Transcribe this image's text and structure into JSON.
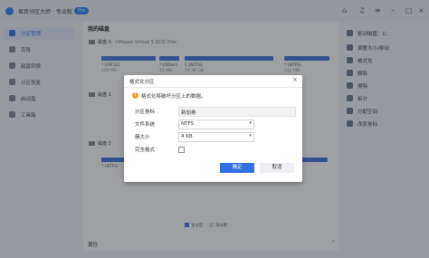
{
  "app": {
    "title": "易我分区大师 · 专业版",
    "badge": "Pro"
  },
  "sidebar": {
    "items": [
      {
        "label": "分区管理",
        "active": true
      },
      {
        "label": "克隆"
      },
      {
        "label": "磁盘转换"
      },
      {
        "label": "分区恢复"
      },
      {
        "label": "启动盘"
      },
      {
        "label": "工具箱"
      }
    ]
  },
  "main": {
    "title": "我的磁盘",
    "disks": [
      {
        "label": "磁盘 0",
        "info": "VMware Virtual S SCSI Disk",
        "parts": [
          {
            "name": "*:(FAT32)",
            "size": "100 MB"
          },
          {
            "name": "*:(Other)",
            "size": "16 MB"
          },
          {
            "name": "C:(NTFS)",
            "size": "59.36 GB"
          },
          {
            "name": "*:(NTFS)",
            "size": "532 MB"
          }
        ]
      },
      {
        "label": "磁盘 1",
        "info": "",
        "parts": []
      },
      {
        "label": "磁盘 2",
        "info": "",
        "parts": [
          {
            "name": "*:(NTFS)",
            "size": ""
          }
        ]
      }
    ],
    "legend": {
      "primary": "主分区",
      "unallocated": "未分配"
    },
    "properties_label": "属性"
  },
  "actions": {
    "items": [
      {
        "label": "驱动磁盘：C:"
      },
      {
        "label": "调整大小/移动"
      },
      {
        "label": "格式化"
      },
      {
        "label": "删除"
      },
      {
        "label": "擦除"
      },
      {
        "label": "拆分"
      },
      {
        "label": "分配空间"
      },
      {
        "label": "改变卷标"
      }
    ]
  },
  "dialog": {
    "title": "格式化分区",
    "close": "×",
    "warning_icon": "!",
    "warning": "格式化将破坏分区上的数据。",
    "fields": {
      "label_name": "分区卷标",
      "label_value": "新加卷",
      "fs_name": "文件系统",
      "fs_value": "NTFS",
      "cluster_name": "簇大小",
      "cluster_value": "4 KB",
      "quick_name": "完全格式"
    },
    "ok_label": "确定",
    "cancel_label": "取消"
  }
}
